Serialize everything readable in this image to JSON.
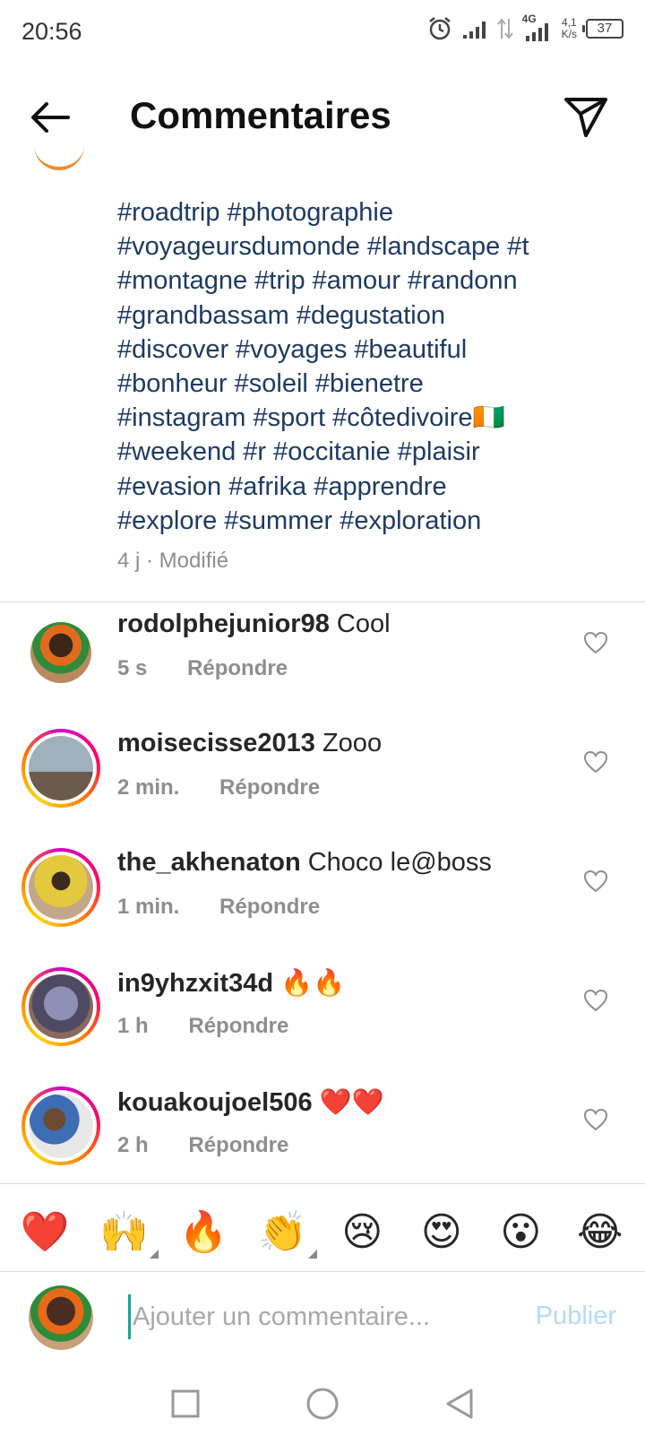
{
  "status_bar": {
    "time": "20:56",
    "network": "4G",
    "speed_value": "4,1",
    "speed_unit": "K/s",
    "battery": "37"
  },
  "header": {
    "title": "Commentaires"
  },
  "caption": {
    "lines": [
      "#roadtrip #photographie",
      "#voyageursdumonde #landscape #t",
      "#montagne #trip #amour #randonn",
      "#grandbassam #degustation",
      "#discover #voyages #beautiful",
      "#bonheur #soleil #bienetre",
      "#instagram #sport #côtedivoire🇨🇮",
      "#weekend #r #occitanie #plaisir",
      "#evasion #afrika #apprendre",
      "#explore #summer #exploration"
    ],
    "meta": "4 j · Modifié"
  },
  "comments": [
    {
      "username": "rodolphejunior98",
      "text": "Cool",
      "time": "5 s",
      "reply_label": "Répondre",
      "story_ring": false,
      "avatar_color": "#e06b1f"
    },
    {
      "username": "moisecisse2013",
      "text": "Zooo",
      "time": "2 min.",
      "reply_label": "Répondre",
      "story_ring": true,
      "avatar_color": "#7a8a95"
    },
    {
      "username": "the_akhenaton",
      "text": "Choco le@boss",
      "time": "1 min.",
      "reply_label": "Répondre",
      "story_ring": true,
      "avatar_color": "#c9b13a"
    },
    {
      "username": "in9yhzxit34d",
      "text": "🔥🔥",
      "time": "1 h",
      "reply_label": "Répondre",
      "story_ring": true,
      "avatar_color": "#6e6f8e"
    },
    {
      "username": "kouakoujoel506",
      "text": "❤️❤️",
      "time": "2 h",
      "reply_label": "Répondre",
      "story_ring": true,
      "avatar_color": "#3d6db3"
    }
  ],
  "reactions": [
    "❤️",
    "🙌",
    "🔥",
    "👏",
    "😢",
    "😍",
    "😮",
    "😂"
  ],
  "composer": {
    "placeholder": "Ajouter un commentaire...",
    "publish_label": "Publier"
  },
  "colors": {
    "hashtag": "#1d3a62",
    "publish": "#b3dbf9",
    "secondary_text": "#8e8e8e"
  }
}
